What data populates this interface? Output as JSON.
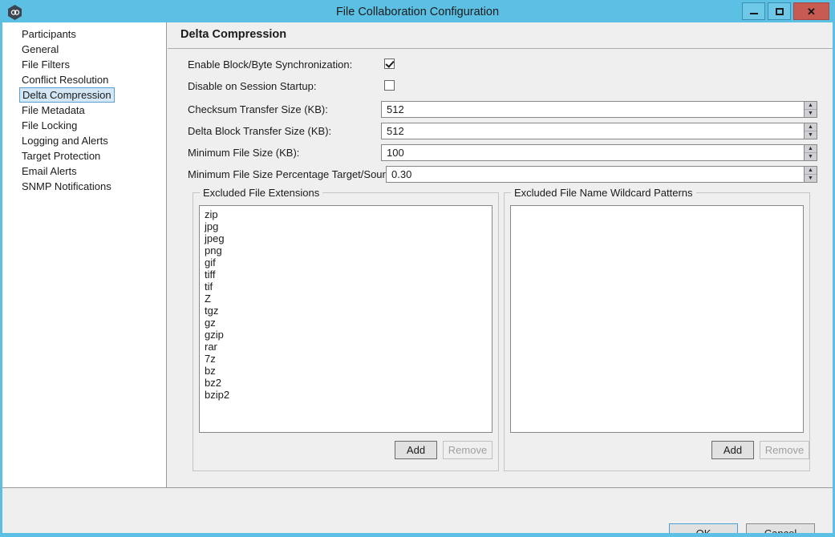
{
  "window": {
    "title": "File Collaboration Configuration",
    "app_icon": "link-hexagon-icon",
    "controls": {
      "minimize": "minimize-icon",
      "maximize": "maximize-icon",
      "close": "✕"
    },
    "accent_color": "#5bc0e4",
    "close_color": "#c75b52"
  },
  "sidebar": {
    "items": [
      {
        "label": "Participants",
        "selected": false
      },
      {
        "label": "General",
        "selected": false
      },
      {
        "label": "File Filters",
        "selected": false
      },
      {
        "label": "Conflict Resolution",
        "selected": false
      },
      {
        "label": "Delta Compression",
        "selected": true
      },
      {
        "label": "File Metadata",
        "selected": false
      },
      {
        "label": "File Locking",
        "selected": false
      },
      {
        "label": "Logging and Alerts",
        "selected": false
      },
      {
        "label": "Target Protection",
        "selected": false
      },
      {
        "label": "Email Alerts",
        "selected": false
      },
      {
        "label": "SNMP Notifications",
        "selected": false
      }
    ],
    "selected_color": "#d3e7f7",
    "selected_border": "#5a9fd4"
  },
  "content": {
    "page_title": "Delta Compression",
    "fields": {
      "enable_block_byte_sync": {
        "label": "Enable Block/Byte Synchronization:",
        "checked": true
      },
      "disable_on_session_startup": {
        "label": "Disable on Session Startup:",
        "checked": false
      },
      "checksum_transfer_size": {
        "label": "Checksum Transfer Size (KB):",
        "value": "512"
      },
      "delta_block_transfer_size": {
        "label": "Delta Block Transfer Size (KB):",
        "value": "512"
      },
      "minimum_file_size": {
        "label": "Minimum File Size (KB):",
        "value": "100"
      },
      "minimum_file_size_percentage": {
        "label": "Minimum File Size Percentage Target/Source:",
        "value": "0.30"
      }
    },
    "excluded_extensions": {
      "group_label": "Excluded File Extensions",
      "items": [
        "zip",
        "jpg",
        "jpeg",
        "png",
        "gif",
        "tiff",
        "tif",
        "Z",
        "tgz",
        "gz",
        "gzip",
        "rar",
        "7z",
        "bz",
        "bz2",
        "bzip2"
      ],
      "add_label": "Add",
      "remove_label": "Remove",
      "remove_enabled": false
    },
    "excluded_wildcards": {
      "group_label": "Excluded File Name Wildcard Patterns",
      "items": [],
      "add_label": "Add",
      "remove_label": "Remove",
      "remove_enabled": false
    }
  },
  "footer": {
    "ok_label": "OK",
    "cancel_label": "Cancel"
  }
}
